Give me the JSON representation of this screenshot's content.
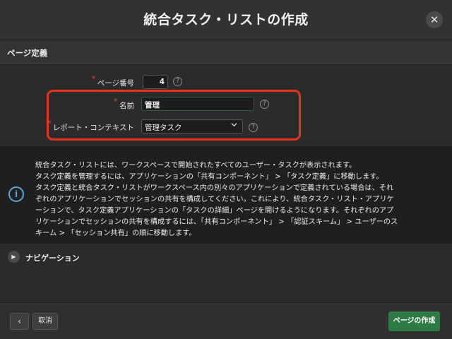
{
  "dialog": {
    "title": "統合タスク・リストの作成",
    "close_glyph": "✕"
  },
  "section": {
    "title": "ページ定義"
  },
  "form": {
    "page_number": {
      "required": "*",
      "label": "ページ番号",
      "value": "4"
    },
    "name": {
      "required": "*",
      "label": "名前",
      "value": "管理"
    },
    "report_context": {
      "required": "*",
      "label": "レポート・コンテキスト",
      "value": "管理タスク"
    },
    "help_glyph": "?"
  },
  "info": {
    "icon": "i",
    "lines": [
      "統合タスク・リストには、ワークスペースで開始されたすべてのユーザー・タスクが表示されます。",
      "タスク定義を管理するには、アプリケーションの「共有コンポーネント」 > 「タスク定義」に移動します。",
      "タスク定義と統合タスク・リストがワークスペース内の別々のアプリケーションで定義されている場合は、それ",
      "ぞれのアプリケーションでセッションの共有を構成してください。これにより、統合タスク・リスト・アプリケ",
      "ーションで、タスク定義アプリケーションの「タスクの詳細」ページを開けるようになります。それぞれのアプ",
      "リケーションでセッションの共有を構成するには、「共有コンポーネント」 > 「認証スキーム」 > ユーザーのス",
      "キーム > 「セッション共有」の順に移動します。"
    ]
  },
  "navigation": {
    "label": "ナビゲーション",
    "toggle_glyph": "▶"
  },
  "footer": {
    "back_glyph": "‹",
    "cancel_label": "取消",
    "create_label": "ページの作成"
  },
  "colors": {
    "highlight": "#e8321e",
    "primary": "#2f7a44",
    "info_icon": "#5aa7d8",
    "required": "#e0483a"
  },
  "icons": [
    "close-icon",
    "help-icon",
    "chevron-down-icon",
    "info-icon",
    "caret-right-icon",
    "chevron-left-icon"
  ]
}
